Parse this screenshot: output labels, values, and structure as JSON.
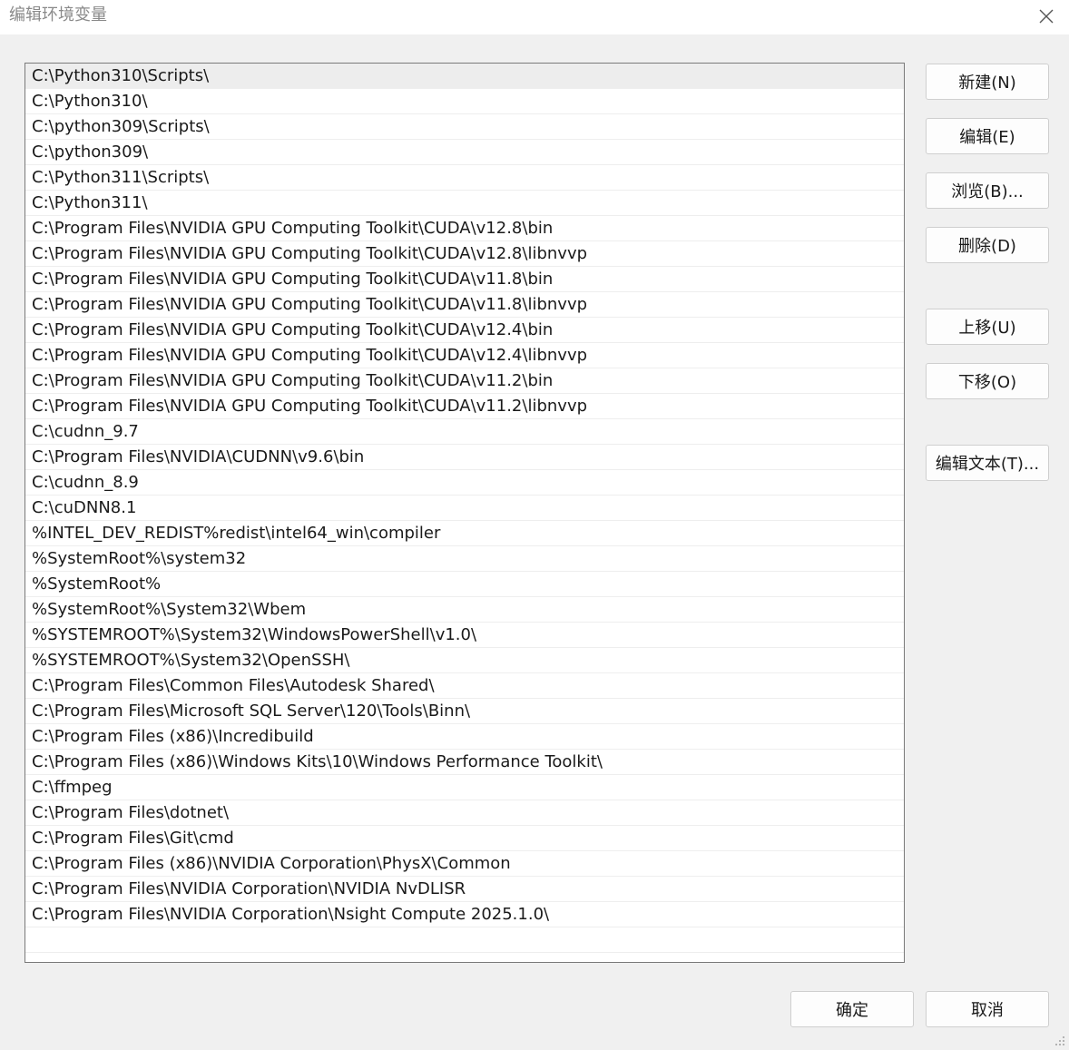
{
  "window": {
    "title": "编辑环境变量"
  },
  "paths": [
    "C:\\Python310\\Scripts\\",
    "C:\\Python310\\",
    "C:\\python309\\Scripts\\",
    "C:\\python309\\",
    "C:\\Python311\\Scripts\\",
    "C:\\Python311\\",
    "C:\\Program Files\\NVIDIA GPU Computing Toolkit\\CUDA\\v12.8\\bin",
    "C:\\Program Files\\NVIDIA GPU Computing Toolkit\\CUDA\\v12.8\\libnvvp",
    "C:\\Program Files\\NVIDIA GPU Computing Toolkit\\CUDA\\v11.8\\bin",
    "C:\\Program Files\\NVIDIA GPU Computing Toolkit\\CUDA\\v11.8\\libnvvp",
    "C:\\Program Files\\NVIDIA GPU Computing Toolkit\\CUDA\\v12.4\\bin",
    "C:\\Program Files\\NVIDIA GPU Computing Toolkit\\CUDA\\v12.4\\libnvvp",
    "C:\\Program Files\\NVIDIA GPU Computing Toolkit\\CUDA\\v11.2\\bin",
    "C:\\Program Files\\NVIDIA GPU Computing Toolkit\\CUDA\\v11.2\\libnvvp",
    "C:\\cudnn_9.7",
    "C:\\Program Files\\NVIDIA\\CUDNN\\v9.6\\bin",
    "C:\\cudnn_8.9",
    "C:\\cuDNN8.1",
    "%INTEL_DEV_REDIST%redist\\intel64_win\\compiler",
    "%SystemRoot%\\system32",
    "%SystemRoot%",
    "%SystemRoot%\\System32\\Wbem",
    "%SYSTEMROOT%\\System32\\WindowsPowerShell\\v1.0\\",
    "%SYSTEMROOT%\\System32\\OpenSSH\\",
    "C:\\Program Files\\Common Files\\Autodesk Shared\\",
    "C:\\Program Files\\Microsoft SQL Server\\120\\Tools\\Binn\\",
    "C:\\Program Files (x86)\\Incredibuild",
    "C:\\Program Files (x86)\\Windows Kits\\10\\Windows Performance Toolkit\\",
    "C:\\ffmpeg",
    "C:\\Program Files\\dotnet\\",
    "C:\\Program Files\\Git\\cmd",
    "C:\\Program Files (x86)\\NVIDIA Corporation\\PhysX\\Common",
    "C:\\Program Files\\NVIDIA Corporation\\NVIDIA NvDLISR",
    "C:\\Program Files\\NVIDIA Corporation\\Nsight Compute 2025.1.0\\"
  ],
  "selected_index": 0,
  "buttons": {
    "new": "新建(N)",
    "edit": "编辑(E)",
    "browse": "浏览(B)...",
    "delete": "删除(D)",
    "move_up": "上移(U)",
    "move_down": "下移(O)",
    "edit_text": "编辑文本(T)...",
    "ok": "确定",
    "cancel": "取消"
  },
  "icons": {
    "close": "close-icon",
    "resize": "resize-grip-icon"
  }
}
